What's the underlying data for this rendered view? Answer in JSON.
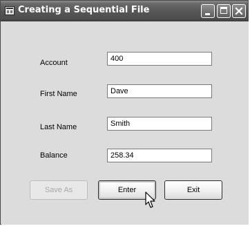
{
  "window": {
    "title": "Creating a Sequential File",
    "icon": "app-form-icon"
  },
  "form": {
    "fields": [
      {
        "label": "Account",
        "value": "400"
      },
      {
        "label": "First Name",
        "value": "Dave"
      },
      {
        "label": "Last Name",
        "value": "Smith"
      },
      {
        "label": "Balance",
        "value": "258.34"
      }
    ]
  },
  "buttons": {
    "save_as": "Save As",
    "enter": "Enter",
    "exit": "Exit",
    "save_as_enabled": false
  }
}
